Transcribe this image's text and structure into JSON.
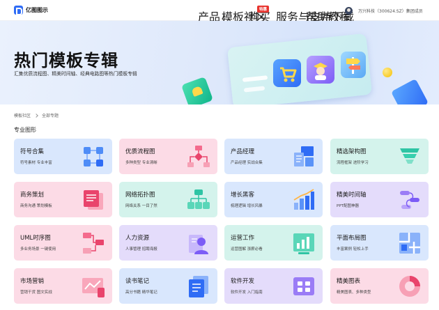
{
  "header": {
    "logo_text": "亿图图示",
    "nav": [
      "产品",
      "模板社区",
      "购买",
      "服务与支持",
      "帮助教程",
      "下载"
    ],
    "hot_badge": "特惠",
    "user_name": "万兴科技（300624.SZ）集团成员"
  },
  "banner": {
    "title": "热门模板专辑",
    "subtitle": "汇集优质流程图、精美时间轴、经典电路图等热门模板专辑"
  },
  "breadcrumb": [
    "模板社区",
    "全部专题"
  ],
  "section": {
    "title": "专业图形"
  },
  "cards": [
    {
      "title": "符号合集",
      "desc": "符号素材 专业丰富",
      "color": "#d9e7fd",
      "icon": "grid-symbols-icon"
    },
    {
      "title": "优质流程图",
      "desc": "多种类型 专业清晰",
      "color": "#fcdbe6",
      "icon": "flowchart-icon"
    },
    {
      "title": "产品经理",
      "desc": "产品经理 实战合集",
      "color": "#d9e7fd",
      "icon": "product-doc-icon"
    },
    {
      "title": "精选架构图",
      "desc": "流程框架 进阶学习",
      "color": "#d4f3ec",
      "icon": "funnel-icon"
    },
    {
      "title": "商务策划",
      "desc": "商务沟通 策划模板",
      "color": "#fcdbe6",
      "icon": "business-doc-icon"
    },
    {
      "title": "网络拓扑图",
      "desc": "网络关系 一目了然",
      "color": "#d4f3ec",
      "icon": "network-icon"
    },
    {
      "title": "增长黑客",
      "desc": "梳理逻辑 增长风暴",
      "color": "#d9e7fd",
      "icon": "bar-chart-icon"
    },
    {
      "title": "精美时间轴",
      "desc": "PPT配图神器",
      "color": "#e4dcfb",
      "icon": "timeline-icon"
    },
    {
      "title": "UML时序图",
      "desc": "多业务场景 一键使用",
      "color": "#fcdbe6",
      "icon": "uml-icon"
    },
    {
      "title": "人力资源",
      "desc": "人事管理 招聘海报",
      "color": "#e4dcfb",
      "icon": "hr-person-icon"
    },
    {
      "title": "运营工作",
      "desc": "运营图解 涨薪必看",
      "color": "#d4f3ec",
      "icon": "ops-chart-icon"
    },
    {
      "title": "平面布局图",
      "desc": "丰富案例 轻松上手",
      "color": "#d9e7fd",
      "icon": "floorplan-icon"
    },
    {
      "title": "市场营销",
      "desc": "营销干货 图文实战",
      "color": "#fcdbe6",
      "icon": "marketing-icon"
    },
    {
      "title": "读书笔记",
      "desc": "高分书籍 精华笔记",
      "color": "#d9e7fd",
      "icon": "notebook-icon"
    },
    {
      "title": "软件开发",
      "desc": "软件开发 入门指南",
      "color": "#e4dcfb",
      "icon": "app-grid-icon"
    },
    {
      "title": "精美图表",
      "desc": "精美图表、多种类型",
      "color": "#fcdbe6",
      "icon": "pie-chart-icon"
    }
  ]
}
